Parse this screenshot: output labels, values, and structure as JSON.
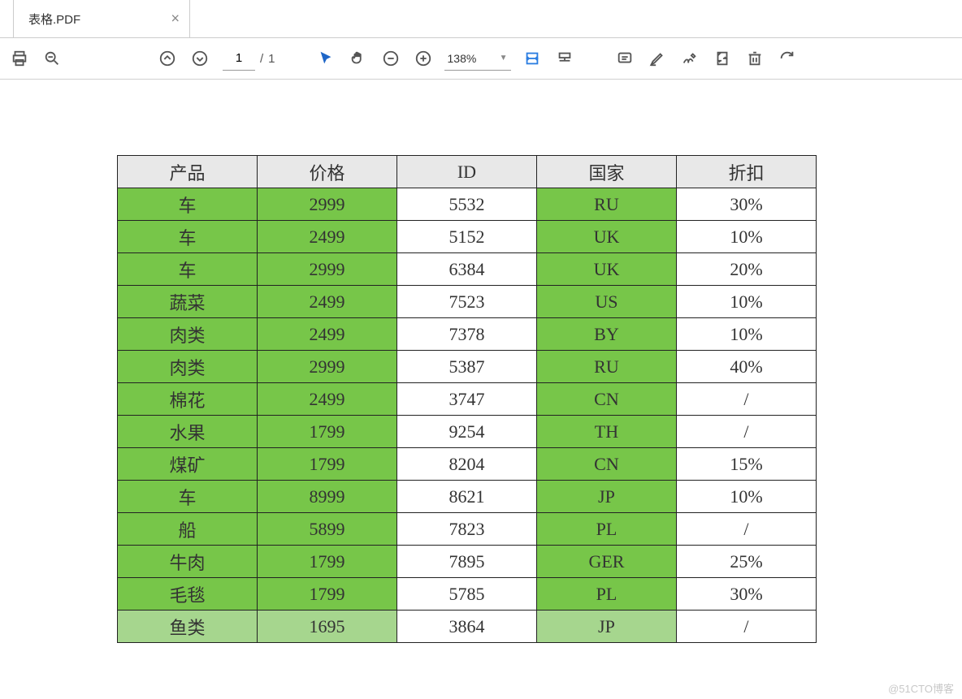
{
  "tab": {
    "title": "表格.PDF"
  },
  "toolbar": {
    "page_current": "1",
    "page_total": "1",
    "page_sep": "/",
    "zoom": "138%"
  },
  "table": {
    "headers": [
      "产品",
      "价格",
      "ID",
      "国家",
      "折扣"
    ],
    "rows": [
      {
        "cells": [
          "车",
          "2999",
          "5532",
          "RU",
          "30%"
        ],
        "green": [
          0,
          1,
          3
        ]
      },
      {
        "cells": [
          "车",
          "2499",
          "5152",
          "UK",
          "10%"
        ],
        "green": [
          0,
          1,
          3
        ]
      },
      {
        "cells": [
          "车",
          "2999",
          "6384",
          "UK",
          "20%"
        ],
        "green": [
          0,
          1,
          3
        ]
      },
      {
        "cells": [
          "蔬菜",
          "2499",
          "7523",
          "US",
          "10%"
        ],
        "green": [
          0,
          1,
          3
        ]
      },
      {
        "cells": [
          "肉类",
          "2499",
          "7378",
          "BY",
          "10%"
        ],
        "green": [
          0,
          1,
          3
        ]
      },
      {
        "cells": [
          "肉类",
          "2999",
          "5387",
          "RU",
          "40%"
        ],
        "green": [
          0,
          1,
          3
        ]
      },
      {
        "cells": [
          "棉花",
          "2499",
          "3747",
          "CN",
          "/"
        ],
        "green": [
          0,
          1,
          3
        ]
      },
      {
        "cells": [
          "水果",
          "1799",
          "9254",
          "TH",
          "/"
        ],
        "green": [
          0,
          1,
          3
        ]
      },
      {
        "cells": [
          "煤矿",
          "1799",
          "8204",
          "CN",
          "15%"
        ],
        "green": [
          0,
          1,
          3
        ]
      },
      {
        "cells": [
          "车",
          "8999",
          "8621",
          "JP",
          "10%"
        ],
        "green": [
          0,
          1,
          3
        ]
      },
      {
        "cells": [
          "船",
          "5899",
          "7823",
          "PL",
          "/"
        ],
        "green": [
          0,
          1,
          3
        ]
      },
      {
        "cells": [
          "牛肉",
          "1799",
          "7895",
          "GER",
          "25%"
        ],
        "green": [
          0,
          1,
          3
        ]
      },
      {
        "cells": [
          "毛毯",
          "1799",
          "5785",
          "PL",
          "30%"
        ],
        "green": [
          0,
          1,
          3
        ]
      },
      {
        "cells": [
          "鱼类",
          "1695",
          "3864",
          "JP",
          "/"
        ],
        "green": [
          0,
          1,
          3
        ],
        "light": true
      }
    ]
  },
  "watermark": "@51CTO博客"
}
